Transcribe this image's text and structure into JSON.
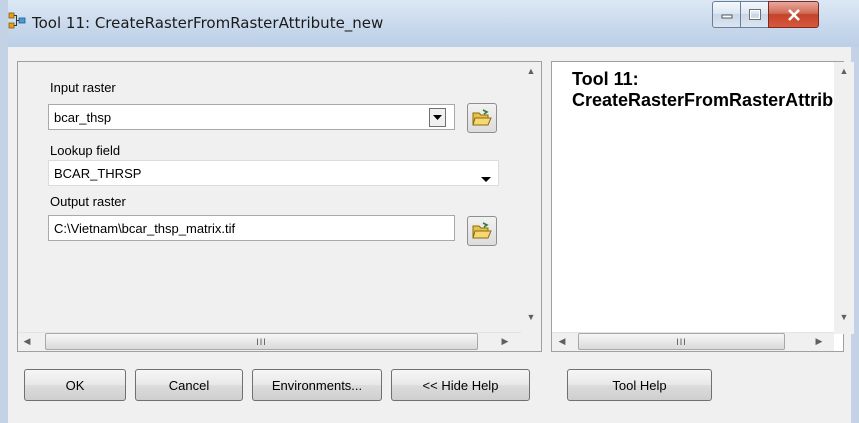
{
  "window": {
    "title": "Tool 11: CreateRasterFromRasterAttribute_new",
    "minimize_label": "minimize",
    "maximize_label": "maximize",
    "close_label": "close"
  },
  "form": {
    "input_raster": {
      "label": "Input raster",
      "value": "bcar_thsp"
    },
    "lookup_field": {
      "label": "Lookup field",
      "value": "BCAR_THRSP"
    },
    "output_raster": {
      "label": "Output raster",
      "value": "C:\\Vietnam\\bcar_thsp_matrix.tif"
    }
  },
  "scroll": {
    "thumb_grip": "III"
  },
  "help": {
    "line1": "Tool 11:",
    "line2": "CreateRasterFromRasterAttribute_new"
  },
  "buttons": {
    "ok": "OK",
    "cancel": "Cancel",
    "environments": "Environments...",
    "hide_help": "<< Hide Help",
    "tool_help": "Tool Help"
  },
  "colors": {
    "close_button": "#c2432b",
    "window_frame": "#c3d2e4",
    "folder_icon": "#e8c14a",
    "arrow_icon": "#2e7d32"
  }
}
